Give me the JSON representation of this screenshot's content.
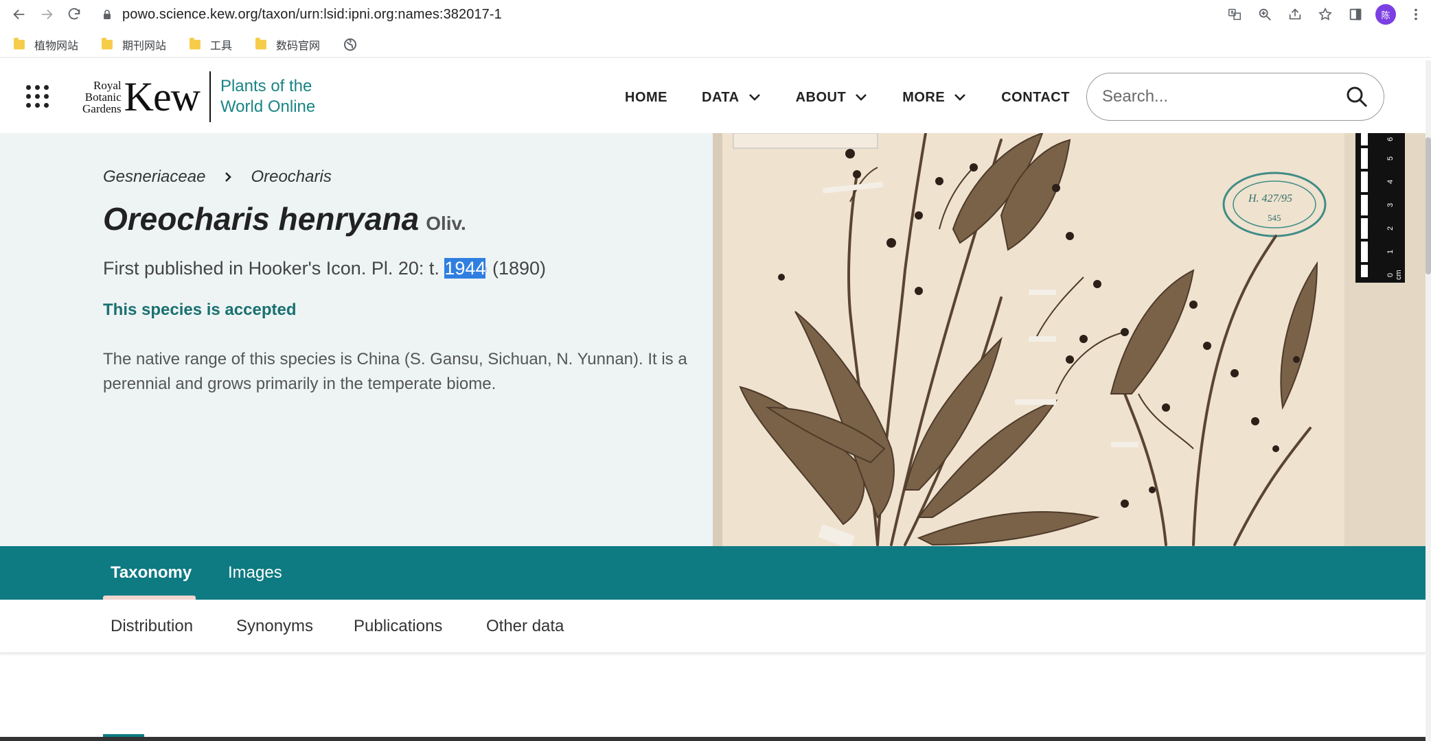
{
  "browser": {
    "url": "powo.science.kew.org/taxon/urn:lsid:ipni.org:names:382017-1",
    "profile_initial": "陈",
    "bookmarks": [
      {
        "label": "植物网站"
      },
      {
        "label": "期刊网站"
      },
      {
        "label": "工具"
      },
      {
        "label": "数码官网"
      }
    ]
  },
  "site": {
    "logo": {
      "line1": "Royal",
      "line2": "Botanic",
      "line3": "Gardens",
      "kew": "Kew",
      "powo_line1": "Plants of the",
      "powo_line2": "World Online"
    },
    "nav": {
      "home": "HOME",
      "data": "DATA",
      "about": "ABOUT",
      "more": "MORE",
      "contact": "CONTACT"
    },
    "search": {
      "placeholder": "Search..."
    }
  },
  "taxon": {
    "breadcrumb_family": "Gesneriaceae",
    "breadcrumb_genus": "Oreocharis",
    "binomial": "Oreocharis henryana",
    "author": "Oliv.",
    "published_prefix": "First published in Hooker's Icon. Pl. 20: t. ",
    "published_selected": "1944",
    "published_suffix": " (1890)",
    "status": "This species is accepted",
    "description": "The native range of this species is China (S. Gansu, Sichuan, N. Yunnan). It is a perennial and grows primarily in the temperate biome."
  },
  "specimen": {
    "stamp_text": "H. 427/95",
    "stamp_number": "545",
    "scale_unit": "cm",
    "scale_marks": [
      "0",
      "1",
      "2",
      "3",
      "4",
      "5",
      "6"
    ]
  },
  "tabs": {
    "taxonomy": "Taxonomy",
    "images": "Images"
  },
  "subtabs": {
    "distribution": "Distribution",
    "synonyms": "Synonyms",
    "publications": "Publications",
    "other": "Other data"
  },
  "colors": {
    "teal": "#0e7a82",
    "accepted": "#1a7070",
    "selection": "#2f7fe0",
    "hero_bg": "#eef4f4"
  }
}
